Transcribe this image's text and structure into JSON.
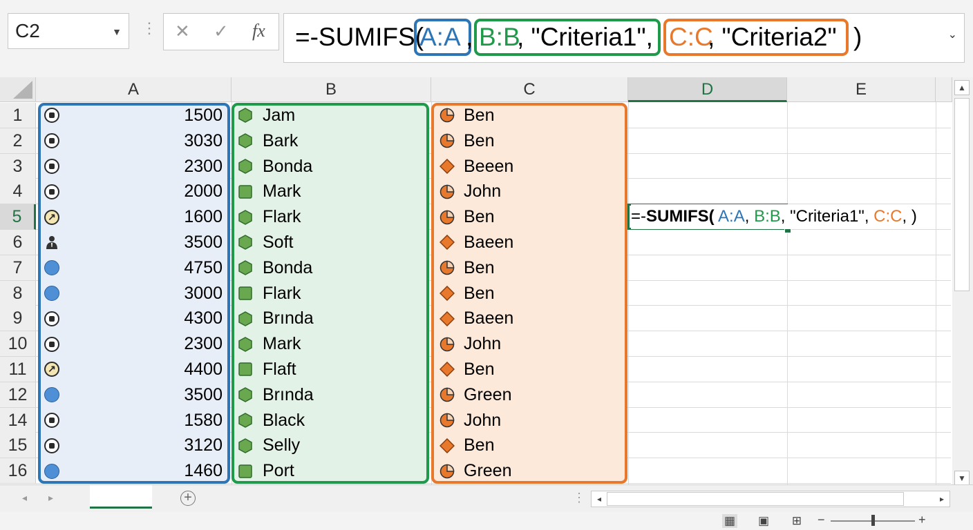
{
  "name_box": {
    "value": "C2"
  },
  "formula_bar": {
    "segments": [
      {
        "text": "=-SUMIFS(",
        "color": "#000000"
      },
      {
        "text": "A:A",
        "color": "#2e75b6",
        "boxed": true
      },
      {
        "text": ",",
        "color": "#000000"
      },
      {
        "text": "B:B, \"Criteria1\",",
        "color": "#1f9a4a",
        "boxed": true,
        "mixed": true
      },
      {
        "text": "C:C, \"Criteria2\"",
        "color": "#e8792c",
        "boxed": true,
        "mixed": true
      },
      {
        "text": ")",
        "color": "#000000"
      }
    ],
    "parts": {
      "p0": "=-SUMIFS(",
      "p1": "A:A",
      "p2": ",",
      "p3a": "B:B",
      "p3b": ", \"Criteria1\",",
      "p4a": "C:C",
      "p4b": ", \"Criteria2\"",
      "p5": ")"
    }
  },
  "fx_labels": {
    "cancel": "✕",
    "enter": "✓",
    "function": "fx"
  },
  "columns": [
    "A",
    "B",
    "C",
    "D",
    "E"
  ],
  "active_column": "D",
  "rows": [
    {
      "num": "1",
      "a_icon": "stop-circle-icon",
      "a": "1500",
      "b_icon": "hexagon-icon",
      "b": "Jam",
      "c_icon": "pie-icon",
      "c": "Ben"
    },
    {
      "num": "2",
      "a_icon": "stop-circle-icon",
      "a": "3030",
      "b_icon": "hexagon-icon",
      "b": "Bark",
      "c_icon": "pie-icon",
      "c": "Ben"
    },
    {
      "num": "3",
      "a_icon": "stop-circle-icon",
      "a": "2300",
      "b_icon": "hexagon-icon",
      "b": "Bonda",
      "c_icon": "diamond-icon",
      "c": "Beeen"
    },
    {
      "num": "4",
      "a_icon": "stop-circle-icon",
      "a": "2000",
      "b_icon": "square-icon",
      "b": "Mark",
      "c_icon": "pie-icon",
      "c": "John"
    },
    {
      "num": "5",
      "a_icon": "arrow-circle-icon",
      "a": "1600",
      "b_icon": "hexagon-icon",
      "b": "Flark",
      "c_icon": "pie-icon",
      "c": "Ben"
    },
    {
      "num": "6",
      "a_icon": "person-icon",
      "a": "3500",
      "b_icon": "hexagon-icon",
      "b": "Soft",
      "c_icon": "diamond-icon",
      "c": "Baeen"
    },
    {
      "num": "7",
      "a_icon": "blue-circle-icon",
      "a": "4750",
      "b_icon": "hexagon-icon",
      "b": "Bonda",
      "c_icon": "pie-icon",
      "c": "Ben"
    },
    {
      "num": "8",
      "a_icon": "blue-circle-icon",
      "a": "3000",
      "b_icon": "square-icon",
      "b": "Flark",
      "c_icon": "diamond-icon",
      "c": "Ben"
    },
    {
      "num": "9",
      "a_icon": "stop-circle-icon",
      "a": "4300",
      "b_icon": "hexagon-icon",
      "b": "Brında",
      "c_icon": "diamond-icon",
      "c": "Baeen"
    },
    {
      "num": "10",
      "a_icon": "stop-circle-icon",
      "a": "2300",
      "b_icon": "hexagon-icon",
      "b": "Mark",
      "c_icon": "pie-icon",
      "c": "John"
    },
    {
      "num": "11",
      "a_icon": "arrow-circle-icon",
      "a": "4400",
      "b_icon": "square-icon",
      "b": "Flaft",
      "c_icon": "diamond-icon",
      "c": "Ben"
    },
    {
      "num": "12",
      "a_icon": "blue-circle-icon",
      "a": "3500",
      "b_icon": "hexagon-icon",
      "b": "Brında",
      "c_icon": "pie-icon",
      "c": "Green"
    },
    {
      "num": "14",
      "a_icon": "stop-circle-icon",
      "a": "1580",
      "b_icon": "hexagon-icon",
      "b": "Black",
      "c_icon": "pie-icon",
      "c": "John"
    },
    {
      "num": "15",
      "a_icon": "stop-circle-icon",
      "a": "3120",
      "b_icon": "hexagon-icon",
      "b": "Selly",
      "c_icon": "diamond-icon",
      "c": "Ben"
    },
    {
      "num": "16",
      "a_icon": "blue-circle-icon",
      "a": "1460",
      "b_icon": "square-icon",
      "b": "Port",
      "c_icon": "pie-icon",
      "c": "Green"
    }
  ],
  "active_row": "5",
  "cell_d5": {
    "p0": "=-",
    "p1": "SUMIFS(",
    "p2": " A:A",
    "p3": ", ",
    "p4": "B:B",
    "p5": ", \"Criteria1\", ",
    "p6": "C:C",
    "p7": ",  )"
  },
  "colors": {
    "range_a": "#2e75b6",
    "range_b": "#1f9a4a",
    "range_c": "#e8792c",
    "excel_green": "#217346"
  },
  "sheet_tabs": {
    "active_label": ""
  },
  "status_bar": {
    "zoom_minus": "−",
    "zoom_plus": "+"
  }
}
